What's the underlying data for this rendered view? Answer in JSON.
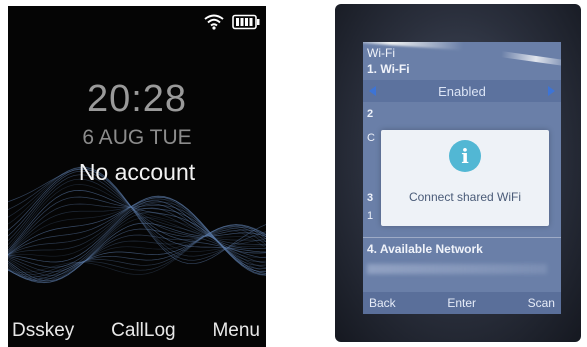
{
  "left_phone": {
    "time": "20:28",
    "date": "6 AUG TUE",
    "account_status": "No account",
    "status_icons": [
      "wifi-icon",
      "battery-icon"
    ],
    "softkeys": [
      "Dsskey",
      "CallLog",
      "Menu"
    ],
    "colors": {
      "background": "#050505",
      "wave": "#5c7aa8",
      "text": "#f2f2f2"
    }
  },
  "right_phone": {
    "title": "Wi-Fi",
    "row1_label": "1. Wi-Fi",
    "row1_value": "Enabled",
    "row2_stub": "2",
    "row2_sub": "C",
    "row3_stub": "3",
    "row3_sub": "1",
    "dialog": {
      "icon": "info-icon",
      "message": "Connect shared WiFi"
    },
    "row4_label": "4. Available Network",
    "softkeys": [
      "Back",
      "Enter",
      "Scan"
    ],
    "colors": {
      "screen": "#6a7fa8",
      "dialog": "#eef2f7",
      "info": "#52b7d4",
      "arrow": "#3d74d6"
    }
  }
}
